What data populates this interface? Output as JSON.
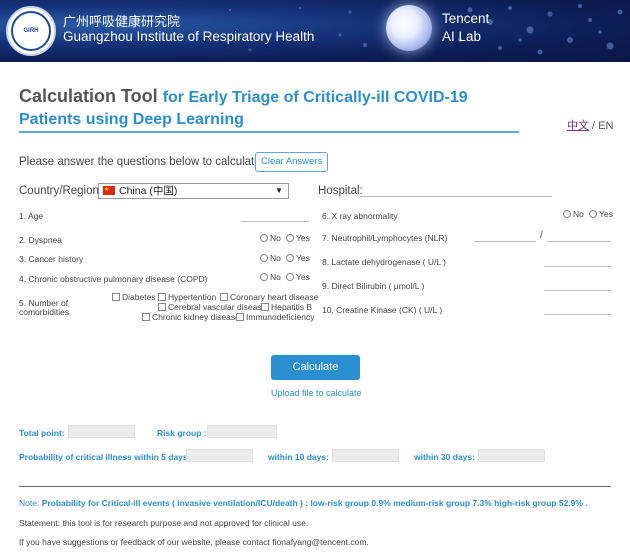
{
  "header": {
    "institute_cn": "广州呼吸健康研究院",
    "institute_en": "Guangzhou Institute of Respiratory Health",
    "logo_text": "GIRH",
    "tencent_line1": "Tencent",
    "tencent_line2": "AI Lab"
  },
  "title": {
    "part1": "Calculation Tool",
    "part2": "for Early Triage of Critically-ill COVID-19",
    "line2": "Patients using Deep Learning"
  },
  "lang": {
    "zh": "中文",
    "sep": " / ",
    "en": "EN"
  },
  "instruction": "Please answer the questions below to calculate.",
  "clear_label": "Clear Answers",
  "country": {
    "label": "Country/Region:",
    "value": "China (中国)"
  },
  "hospital": {
    "label": "Hospital:"
  },
  "questions": {
    "q1": "1. Age",
    "q2": "2. Dyspnea",
    "q3": "3. Cancer history",
    "q4": "4. Chronic obstructive pulmonary disease (COPD)",
    "q5a": "5. Number of",
    "q5b": "comorbidities",
    "q6": "6. X ray abnormality",
    "q7": "7. Neutrophil/Lymphocytes (NLR)",
    "q7_sep": "/",
    "q8": "8. Lactate dehydrogenase ( U/L )",
    "q9": "9. Direct Bilirubin ( μmol/L )",
    "q10": "10. Creatine Kinase (CK) ( U/L )"
  },
  "options": {
    "no": "No",
    "yes": "Yes"
  },
  "comorbidities": {
    "diabetes": "Diabetes",
    "hypertension": "Hypertention",
    "chd": "Coronary heart disease",
    "cvd": "Cerebral vascular disease",
    "hepb": "Hepatitis B",
    "ckd": "Chronic kidney disease",
    "immuno": "Immunodeficiency"
  },
  "calculate_label": "Calculate",
  "upload_label": "Upload file to calculate",
  "results": {
    "total": "Total point:",
    "risk": "Risk group :",
    "prob5": "Probability of critical illness within 5 days:",
    "prob10": "within 10 days:",
    "prob30": "within 30 days:"
  },
  "note": {
    "prefix": "Note: ",
    "body": "Probability for Critical-ill events ( invasive ventilation/ICU/death ) : low-risk group 0.9% medium-risk group 7.3% high-risk group 52.9% ."
  },
  "statement": "Statement: this tool is for research purpose and not approved for clinical use.",
  "contact": "If you have suggestions or feedback of our website, please contact fionafyang@tencent.com."
}
